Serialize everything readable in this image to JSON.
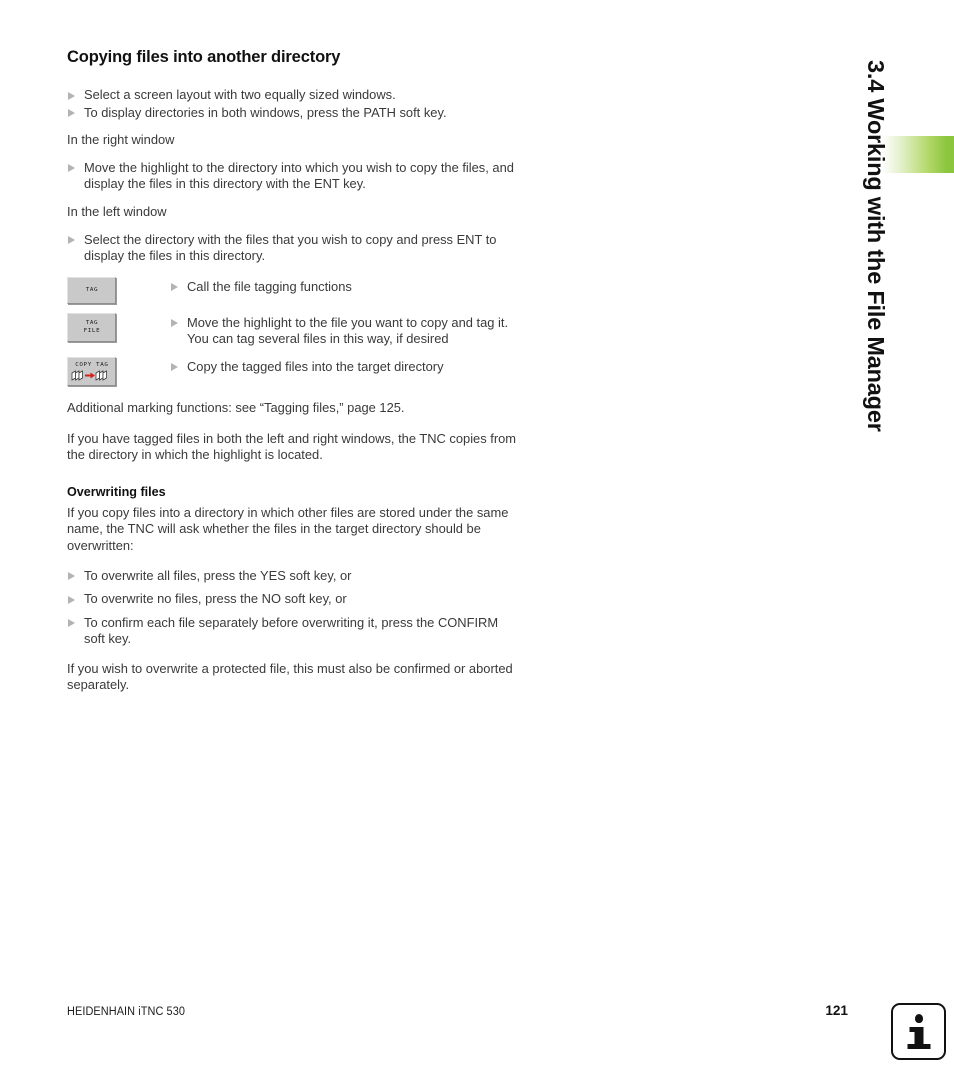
{
  "chapter_tab": {
    "title": "3.4 Working with the File Manager",
    "accent_color": "#8cc63f"
  },
  "page": {
    "heading": "Copying files into another directory",
    "intro_bullets": [
      "Select a screen layout with two equally sized windows.",
      "To display directories in both windows, press the PATH soft key."
    ],
    "right_window_label": "In the right window",
    "right_window_bullets": [
      "Move the highlight to the directory into which you wish to copy the files, and display the files in this directory with the ENT key."
    ],
    "left_window_label": "In the left window",
    "left_window_bullets": [
      "Select the directory with the files that you wish to copy and press ENT to display the files in this directory."
    ],
    "softkey_steps": [
      {
        "key_line1": "TAG",
        "key_line2": "",
        "key_icon": "tag-softkey",
        "text": "Call the file tagging functions"
      },
      {
        "key_line1": "TAG",
        "key_line2": "FILE",
        "key_icon": "tag-file-softkey",
        "text": "Move the highlight to the file you want to copy and tag it. You can tag several files in this way, if desired"
      },
      {
        "key_line1": "COPY TAG",
        "key_line2": "",
        "key_icon": "copy-tagged-files-softkey",
        "text": "Copy the tagged files into the target directory"
      }
    ],
    "cross_reference": "Additional marking functions: see “Tagging files,” page 125.",
    "note_paragraph": "If you have tagged files in both the left and right windows, the TNC copies from the directory in which the highlight is located.",
    "overwriting": {
      "heading": "Overwriting files",
      "intro": "If you copy files into a directory in which other files are stored under the same name, the TNC will ask whether the files in the target directory should be overwritten:",
      "bullets": [
        "To overwrite all files, press the YES soft key, or",
        "To overwrite no files, press the NO soft key, or",
        "To confirm each file separately before overwriting it, press the CONFIRM soft key."
      ],
      "closing": "If you wish to overwrite a protected file, this must also be confirmed or aborted separately."
    }
  },
  "footer": {
    "product": "HEIDENHAIN iTNC 530",
    "page_number": "121",
    "info_icon": "info-icon"
  }
}
